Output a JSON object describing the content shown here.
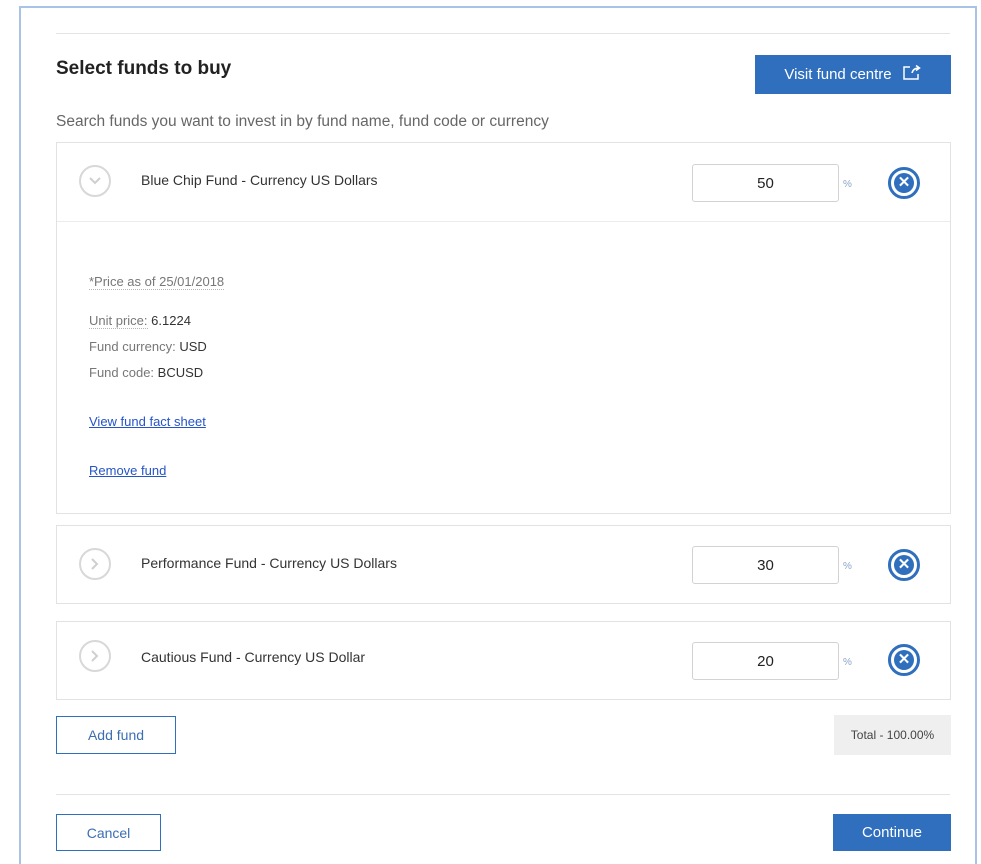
{
  "page": {
    "title": "Select funds to buy",
    "subtitle": "Search funds you want to invest in by fund name, fund code or currency"
  },
  "header": {
    "visit_button_label": "Visit fund centre",
    "visit_button_icon": "external-link-icon"
  },
  "funds": [
    {
      "name": "Blue Chip Fund - Currency US Dollars",
      "percent": "50",
      "expanded": true,
      "details": {
        "price_as_of": "*Price as of 25/01/2018",
        "unit_price_label": "Unit price:",
        "unit_price_value": "6.1224",
        "currency_label": "Fund currency:",
        "currency_value": "USD",
        "code_label": "Fund code:",
        "code_value": "BCUSD",
        "fact_sheet_link": "View fund fact sheet",
        "remove_link": "Remove fund"
      }
    },
    {
      "name": "Performance Fund - Currency US Dollars",
      "percent": "30",
      "expanded": false
    },
    {
      "name": "Cautious Fund - Currency US Dollar",
      "percent": "20",
      "expanded": false
    }
  ],
  "percent_symbol": "%",
  "add_fund_label": "Add fund",
  "total_label": "Total - 100.00%",
  "footer": {
    "cancel_label": "Cancel",
    "continue_label": "Continue"
  },
  "colors": {
    "primary": "#2f6fbd",
    "link": "#2454c7",
    "frame_border": "#a9c3e6"
  }
}
